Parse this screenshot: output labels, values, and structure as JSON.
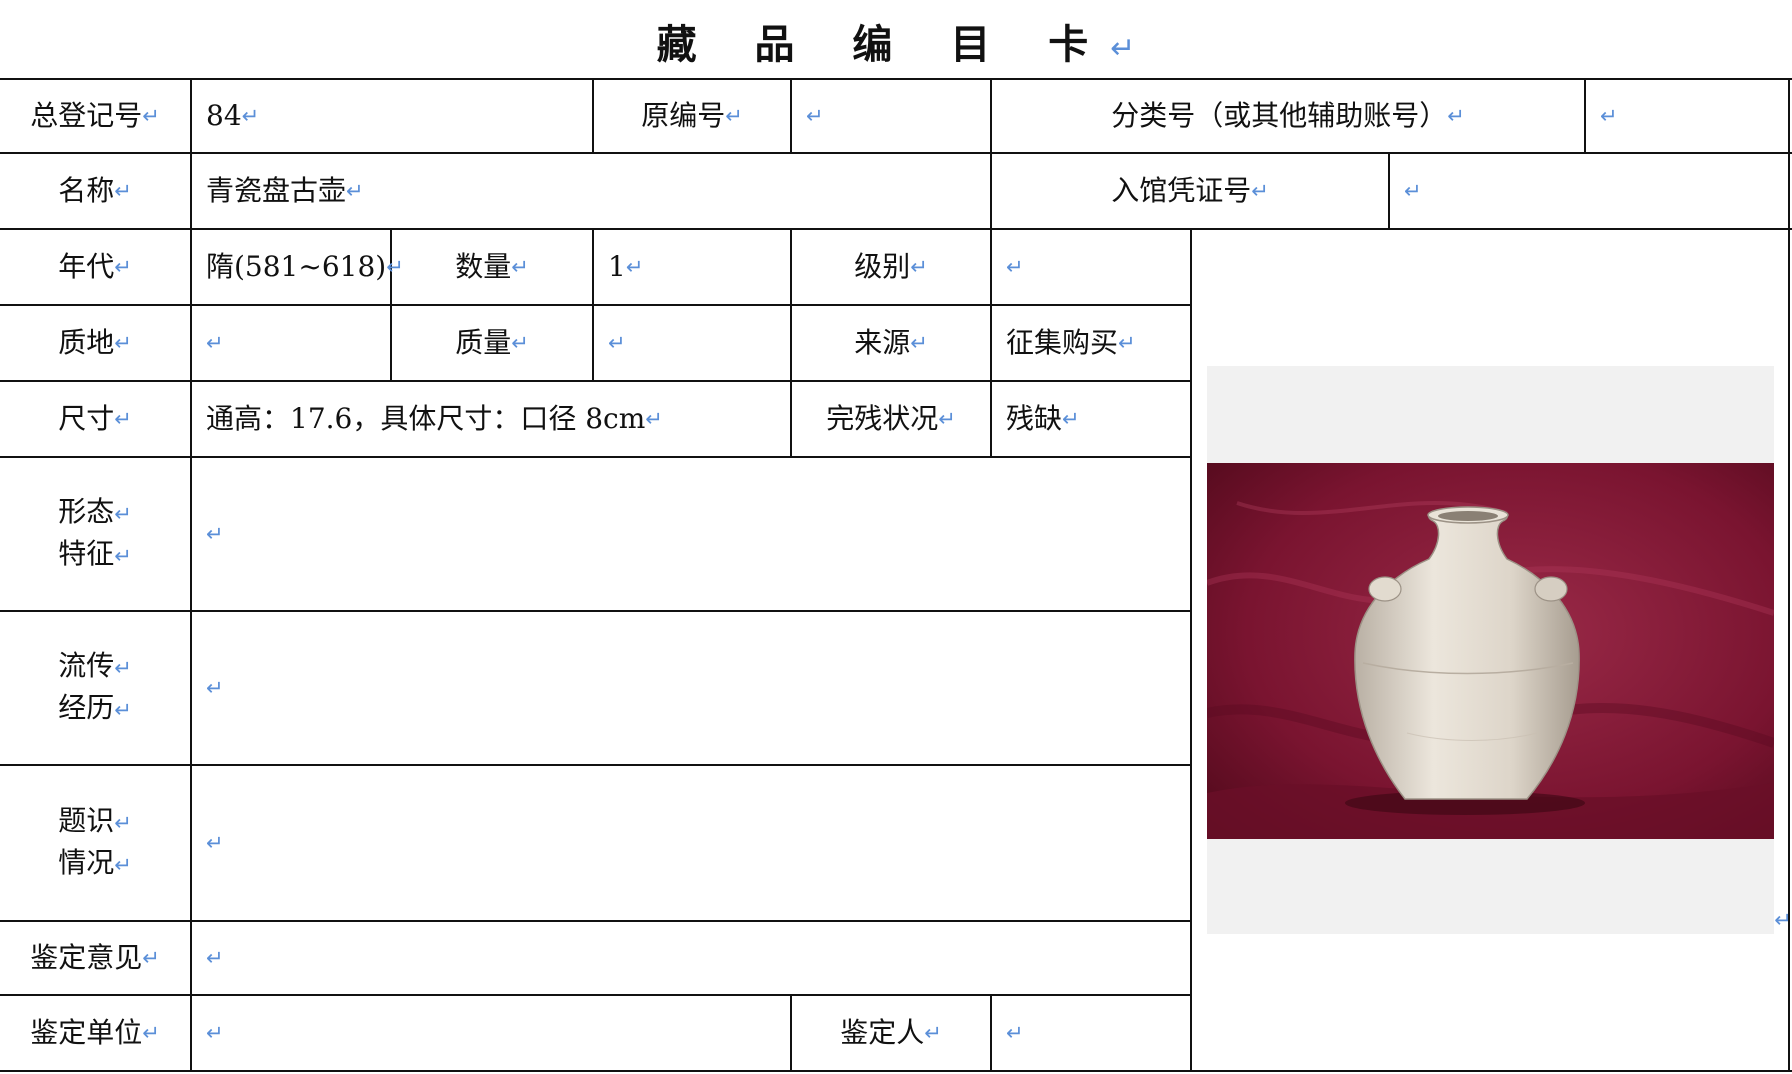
{
  "title": "藏 品 编 目 卡",
  "return_mark": "↵",
  "rows": {
    "r1": {
      "total_reg_no_label": "总登记号",
      "total_reg_no_value": "84",
      "orig_no_label": "原编号",
      "orig_no_value": "",
      "class_no_label": "分类号（或其他辅助账号）",
      "class_no_value": ""
    },
    "r2": {
      "name_label": "名称",
      "name_value": "青瓷盘古壶",
      "voucher_label": "入馆凭证号",
      "voucher_value": ""
    },
    "r3": {
      "era_label": "年代",
      "era_value": "隋(581~618)",
      "qty_label": "数量",
      "qty_value": "1",
      "grade_label": "级别",
      "grade_value": ""
    },
    "r4": {
      "material_label": "质地",
      "material_value": "",
      "weight_label": "质量",
      "weight_value": "",
      "source_label": "来源",
      "source_value": "征集购买"
    },
    "r5": {
      "size_label": "尺寸",
      "size_value": "通高：17.6，具体尺寸：口径 8cm",
      "condition_label": "完残状况",
      "condition_value": "残缺"
    },
    "r6": {
      "form_label_1": "形态",
      "form_label_2": "特征",
      "form_value": ""
    },
    "r7": {
      "history_label_1": "流传",
      "history_label_2": "经历",
      "history_value": ""
    },
    "r8": {
      "inscription_label_1": "题识",
      "inscription_label_2": "情况",
      "inscription_value": ""
    },
    "r9": {
      "appraisal_label": "鉴定意见",
      "appraisal_value": ""
    },
    "r10": {
      "appraisal_unit_label": "鉴定单位",
      "appraisal_unit_value": "",
      "appraiser_label": "鉴定人",
      "appraiser_value": ""
    }
  },
  "photo": {
    "icon": "celadon-vase-photo",
    "backdrop_color": "#7a1430",
    "vase_color": "#e4ddd2"
  },
  "colors": {
    "return_mark": "#5b8fd8",
    "line": "#111111"
  }
}
